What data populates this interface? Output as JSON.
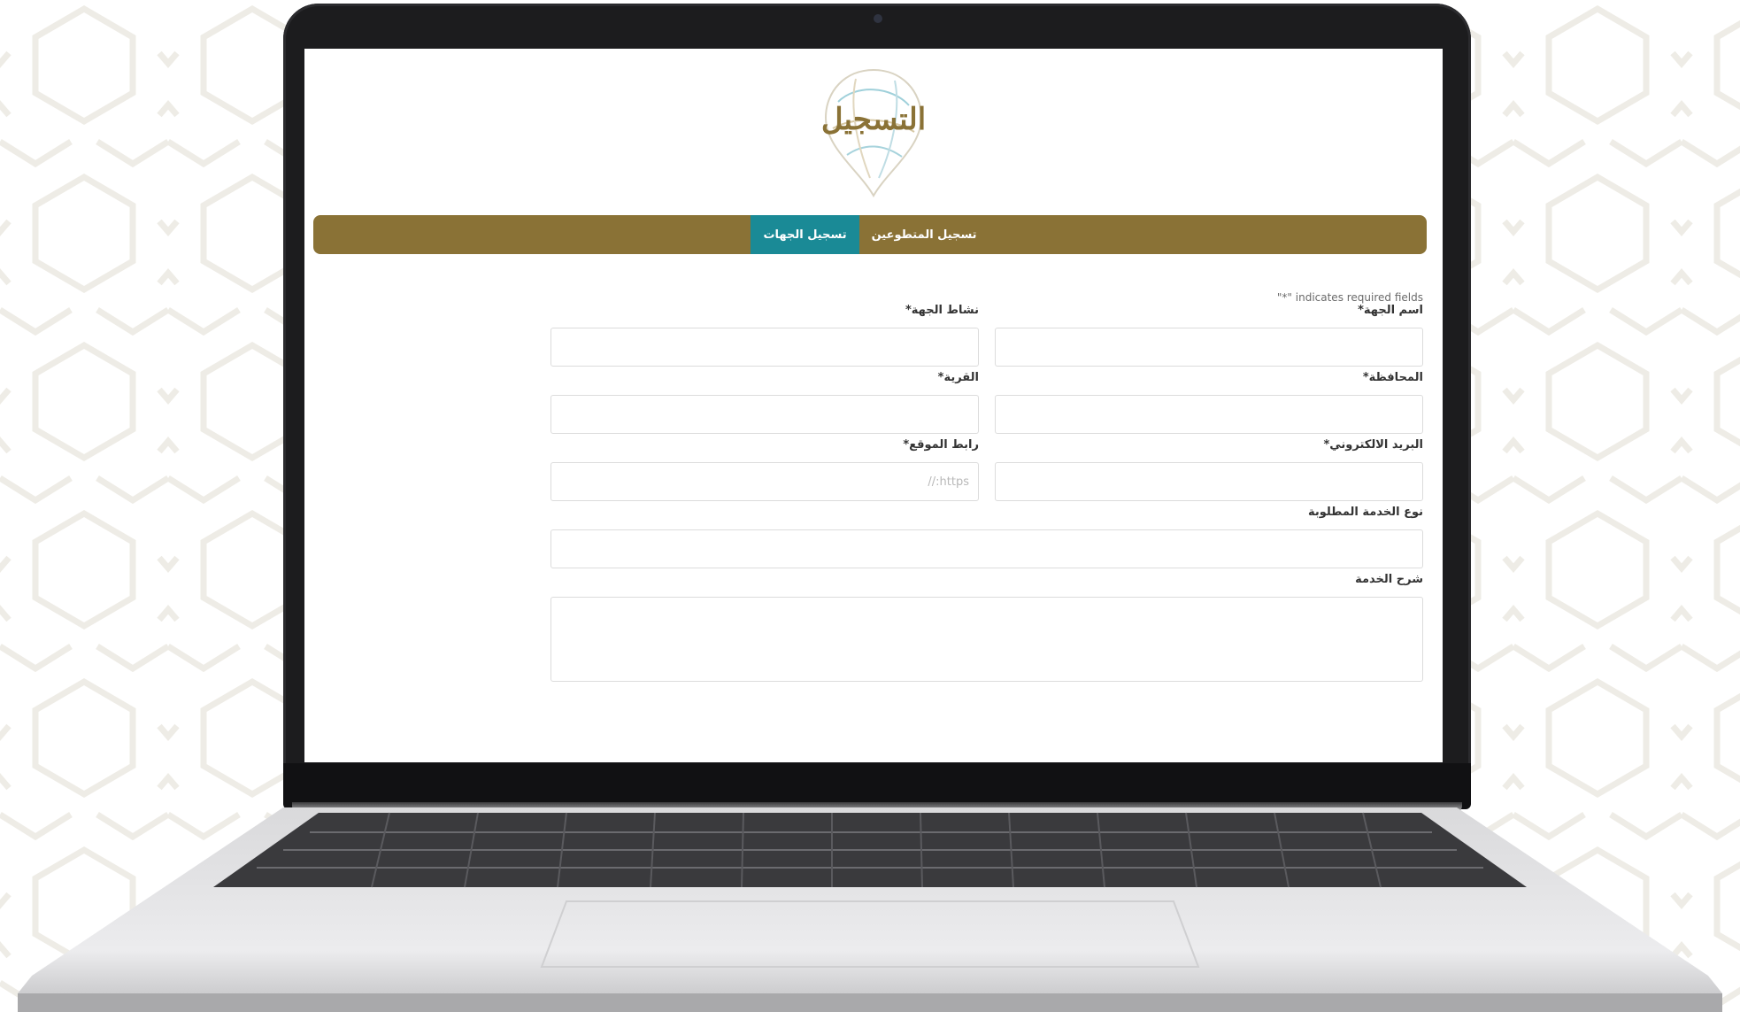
{
  "brand": {
    "title": "التسجيل",
    "accent_color": "#8a7236",
    "active_tab_color": "#1a8a96"
  },
  "tabs": [
    {
      "label": "تسجيل المتطوعين",
      "active": false
    },
    {
      "label": "تسجيل الجهات",
      "active": true
    }
  ],
  "form": {
    "required_note": "\"*\" indicates required fields",
    "fields": {
      "entity_name": {
        "label": "اسم الجهة*",
        "value": "",
        "placeholder": ""
      },
      "entity_activity": {
        "label": "نشاط الجهة*",
        "value": "",
        "placeholder": ""
      },
      "governorate": {
        "label": "المحافظة*",
        "value": "",
        "placeholder": ""
      },
      "village": {
        "label": "القرية*",
        "value": "",
        "placeholder": ""
      },
      "email": {
        "label": "البريد الالكتروني*",
        "value": "",
        "placeholder": ""
      },
      "website": {
        "label": "رابط الموقع*",
        "value": "",
        "placeholder": "https://"
      },
      "service_type": {
        "label": "نوع الخدمة المطلوبة",
        "value": "",
        "placeholder": ""
      },
      "service_description": {
        "label": "شرح الخدمة",
        "value": "",
        "placeholder": ""
      }
    }
  },
  "icons": [
    "registration-logo-icon",
    "camera-icon"
  ]
}
